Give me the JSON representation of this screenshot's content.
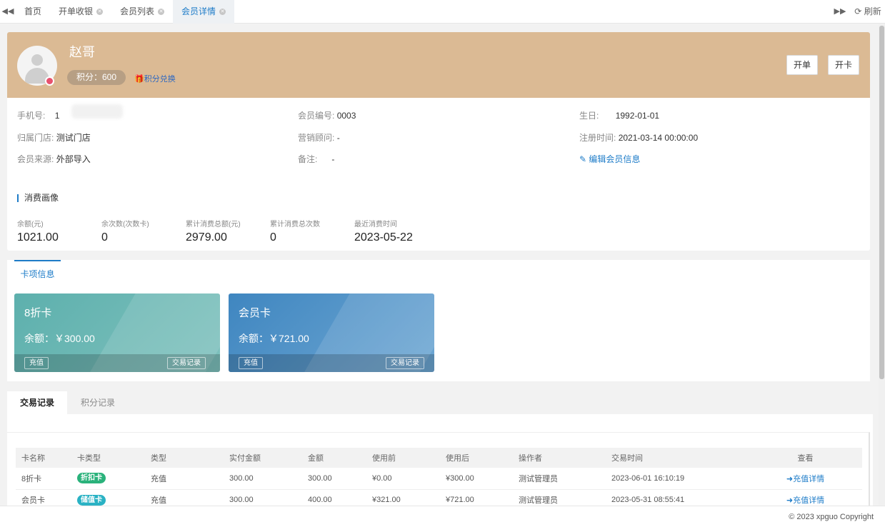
{
  "tabbar": {
    "left_arrow": "◀◀",
    "tabs": [
      {
        "label": "首页",
        "closable": false,
        "active": false
      },
      {
        "label": "开单收银",
        "closable": true,
        "active": false
      },
      {
        "label": "会员列表",
        "closable": true,
        "active": false
      },
      {
        "label": "会员详情",
        "closable": true,
        "active": true
      }
    ],
    "right_arrow": "▶▶",
    "refresh_label": "刷新"
  },
  "member": {
    "name": "赵哥",
    "points_label": "积分：600",
    "points_exchange": "积分兑换",
    "btn_order": "开单",
    "btn_card": "开卡",
    "info": {
      "phone_label": "手机号:",
      "phone_value": "1",
      "member_no_label": "会员编号:",
      "member_no_value": "0003",
      "birthday_label": "生日:",
      "birthday_value": "1992-01-01",
      "store_label": "归属门店:",
      "store_value": "测试门店",
      "advisor_label": "营销顾问:",
      "advisor_value": "-",
      "register_label": "注册时间:",
      "register_value": "2021-03-14 00:00:00",
      "source_label": "会员来源:",
      "source_value": "外部导入",
      "remark_label": "备注:",
      "remark_value": "-",
      "edit_link": "编辑会员信息"
    },
    "profile_title": "消费画像",
    "stats": [
      {
        "label": "余额(元)",
        "value": "1021.00"
      },
      {
        "label": "余次数(次数卡)",
        "value": "0"
      },
      {
        "label": "累计消费总额(元)",
        "value": "2979.00"
      },
      {
        "label": "累计消费总次数",
        "value": "0"
      },
      {
        "label": "最近消费时间",
        "value": "2023-05-22"
      }
    ]
  },
  "cards_section": {
    "tab_label": "卡项信息",
    "cards": [
      {
        "name": "8折卡",
        "balance": "余额：￥300.00",
        "recharge": "充值",
        "records": "交易记录"
      },
      {
        "name": "会员卡",
        "balance": "余额：￥721.00",
        "recharge": "充值",
        "records": "交易记录"
      }
    ]
  },
  "records": {
    "tabs": [
      "交易记录",
      "积分记录"
    ],
    "columns": [
      "卡名称",
      "卡类型",
      "类型",
      "实付金额",
      "金额",
      "使用前",
      "使用后",
      "操作者",
      "交易时间",
      "查看"
    ],
    "rows": [
      {
        "card_name": "8折卡",
        "card_type": "折扣卡",
        "type_color": "#2ab27b",
        "type": "充值",
        "paid": "300.00",
        "amount": "300.00",
        "before": "¥0.00",
        "after": "¥300.00",
        "operator": "测试管理员",
        "time": "2023-06-01 16:10:19",
        "view": "充值详情"
      },
      {
        "card_name": "会员卡",
        "card_type": "储值卡",
        "type_color": "#2ab2c4",
        "type": "充值",
        "paid": "300.00",
        "amount": "400.00",
        "before": "¥321.00",
        "after": "¥721.00",
        "operator": "测试管理员",
        "time": "2023-05-31 08:55:41",
        "view": "充值详情"
      }
    ]
  },
  "footer": {
    "copyright": "© 2023 xpguo Copyright"
  },
  "colors": {
    "header_bg": "#dbba94",
    "accent": "#1e7cc8",
    "card1": "#5db0ad",
    "card2": "#3f86c0"
  }
}
